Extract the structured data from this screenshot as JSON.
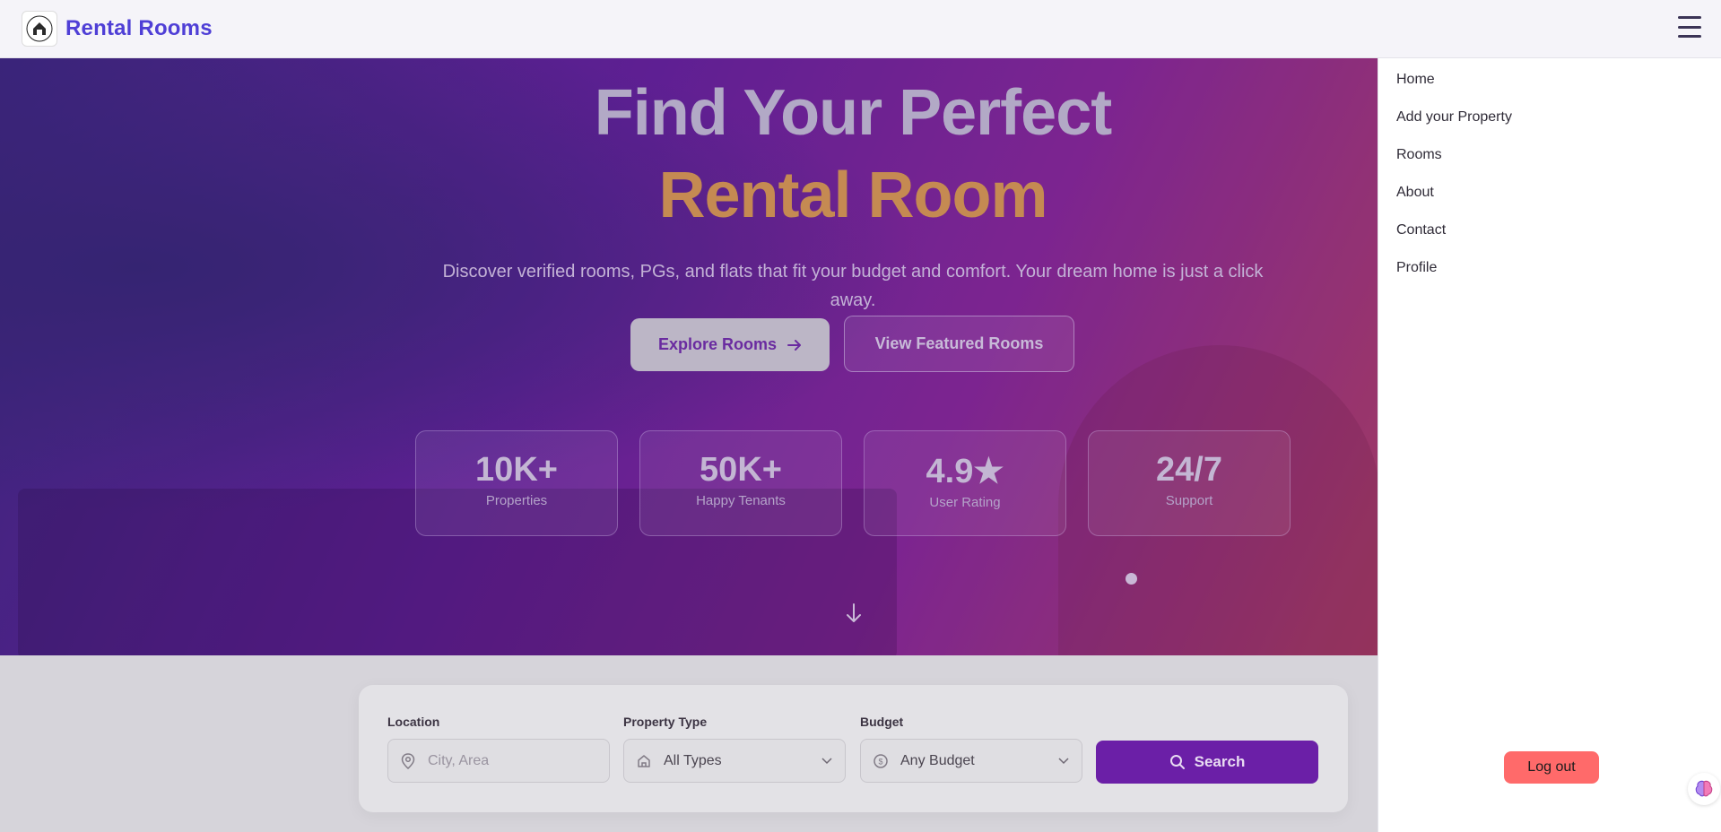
{
  "header": {
    "brand": "Rental Rooms",
    "logo_icon": "house-logo-icon",
    "menu_icon": "hamburger-menu-icon"
  },
  "hero": {
    "title_line1": "Find Your Perfect",
    "title_line2": "Rental Room",
    "subtitle": "Discover verified rooms, PGs, and flats that fit your budget and comfort. Your dream home is just a click away.",
    "explore_label": "Explore Rooms",
    "featured_label": "View Featured Rooms",
    "stats": [
      {
        "value": "10K+",
        "label": "Properties"
      },
      {
        "value": "50K+",
        "label": "Happy Tenants"
      },
      {
        "value": "4.9★",
        "label": "User Rating"
      },
      {
        "value": "24/7",
        "label": "Support"
      }
    ]
  },
  "search": {
    "location_label": "Location",
    "location_placeholder": "City, Area",
    "type_label": "Property Type",
    "type_value": "All Types",
    "budget_label": "Budget",
    "budget_value": "Any Budget",
    "search_label": "Search"
  },
  "menu": {
    "items": [
      "Home",
      "Add your Property",
      "Rooms",
      "About",
      "Contact",
      "Profile"
    ],
    "logout_label": "Log out"
  },
  "colors": {
    "brand": "#4f3fd6",
    "hero_gradient_start": "#432a8c",
    "hero_gradient_end": "#b8436f",
    "accent_gold": "#c58a52",
    "search_button": "#6b1fa7",
    "logout": "#ff6a6a"
  }
}
